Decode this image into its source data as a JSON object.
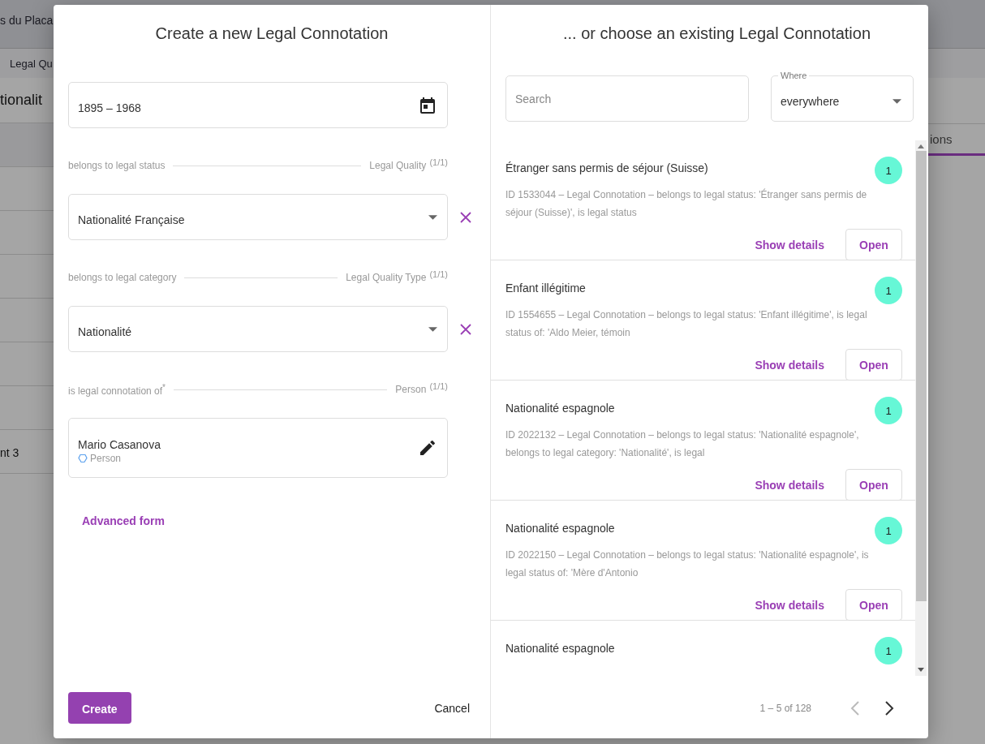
{
  "background": {
    "header_text": "s du Placa",
    "tab": "Legal Qu",
    "heading": "tionalit",
    "row_text": "nt 3",
    "right_tab": "ions"
  },
  "create": {
    "title": "Create a new Legal Connotation",
    "date_field": {
      "value": "1895 – 1968"
    },
    "fields": [
      {
        "kind": "select",
        "label": "belongs to legal status",
        "target": "Legal Quality",
        "count": "(1/1)",
        "value": "Nationalité Française"
      },
      {
        "kind": "select",
        "label": "belongs to legal category",
        "target": "Legal Quality Type",
        "count": "(1/1)",
        "value": "Nationalité"
      },
      {
        "kind": "entity",
        "label": "is legal connotation of$^{*}$",
        "target": "Person",
        "count": "(1/1)",
        "value": "Mario Casanova",
        "subtitle": "Person"
      }
    ],
    "advanced_link": "Advanced form",
    "create_button": "Create",
    "cancel_button": "Cancel"
  },
  "existing": {
    "title": "... or choose an existing Legal Connotation",
    "search": {
      "placeholder": "Search"
    },
    "where": {
      "label": "Where",
      "value": "everywhere"
    },
    "results": [
      {
        "title": "Étranger sans permis de séjour (Suisse)",
        "count": "1",
        "description": "ID 1533044 – Legal Connotation – belongs to legal status: 'Étranger sans permis de séjour (Suisse)', is legal status",
        "details": "Show details",
        "open": "Open"
      },
      {
        "title": "Enfant illégitime",
        "count": "1",
        "description": "ID 1554655 – Legal Connotation – belongs to legal status: 'Enfant illégitime', is legal status of: 'Aldo Meier, témoin",
        "details": "Show details",
        "open": "Open"
      },
      {
        "title": "Nationalité espagnole",
        "count": "1",
        "description": "ID 2022132 – Legal Connotation – belongs to legal status: 'Nationalité espagnole', belongs to legal category: 'Nationalité', is legal",
        "details": "Show details",
        "open": "Open"
      },
      {
        "title": "Nationalité espagnole",
        "count": "1",
        "description": "ID 2022150 – Legal Connotation – belongs to legal status: 'Nationalité espagnole', is legal status of: 'Mère d'Antonio",
        "details": "Show details",
        "open": "Open"
      },
      {
        "title": "Nationalité espagnole",
        "count": "1"
      }
    ],
    "pagination": {
      "range": "1 – 5 of 128",
      "prev_disabled": true,
      "next_disabled": false
    }
  }
}
